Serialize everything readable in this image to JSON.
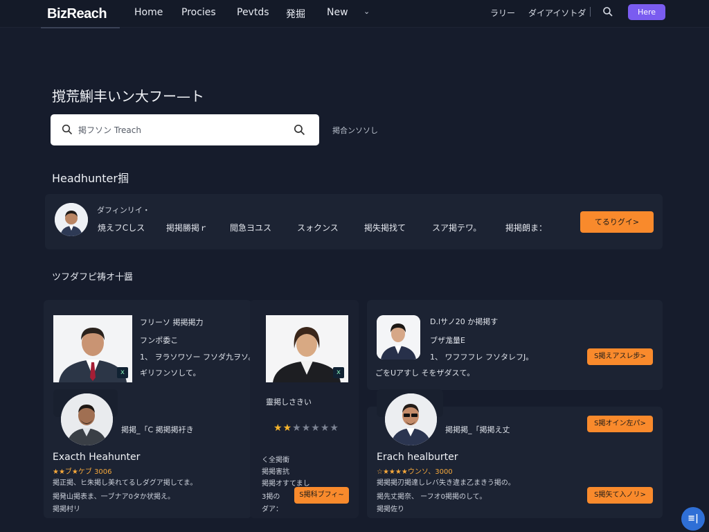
{
  "nav": {
    "logo": "BizReach",
    "links": [
      "Home",
      "Procies",
      "Pevtds",
      "発掘",
      "New"
    ],
    "right_links": [
      "ラリー",
      "ダイアイソトダ"
    ],
    "cta": "Here"
  },
  "hero": {
    "title": "撹荒鯏丰いン大フー—ト",
    "search_value": "掲フソン Treach",
    "search_aside": "掲合ンソソし"
  },
  "featured": {
    "heading": "Headhunter掴",
    "subtitle": "ダフィンリイ・",
    "items": [
      "焼えフCしス",
      "掲掲勝掲ｒ",
      "閲急ヨユス",
      "スォクンス",
      "掲失掲找て",
      "スア掲テワ。",
      "掲掲朗ま："
    ],
    "button": "てるりグイ>"
  },
  "section2": {
    "heading": "ツフダフピ祷オ十醤"
  },
  "cards": {
    "c1": {
      "title": "フリーソ 掲掲掲力",
      "line2": "フンポ委こ",
      "line3": "1、 ヲラソワソー フソダ九ヲソ。",
      "line4": "ギリフンソして。",
      "badge": "x"
    },
    "c2": {
      "badge": "x",
      "caption": "靈掲しさきい",
      "lines": [
        "く全掲衝",
        "掲掲害抗",
        "掲掲オすてまし",
        "3掲の",
        "ダア："
      ],
      "button": "S掲科ブフィ~"
    },
    "c3": {
      "title": "D.lサノ20 か掲掲す",
      "line2": "ブザ尨量E",
      "line3": "1、 ワフフフレ フソタレフJ。",
      "line4": "ごをUアすし そをザダスて。",
      "button": "S掲えアスレ步>"
    },
    "c4": {
      "subtitle": "掲掲_「C 掲掲掲衧き",
      "name": "Exacth Heahunter",
      "rating_text": "★★ブ★ケブ 3006",
      "desc1": "掲正掲、ヒ朱掲し美れてるしダグア掲してま。",
      "desc2": "掲発山掲表ま、一ブナア0タか状掲え。",
      "desc3": "掲掲村リ"
    },
    "c5": {
      "subtitle": "掲掲掲_「掲掲え丈",
      "name": "Erach healburter",
      "rating_text": "☆★★★★ウンソ、3000",
      "desc1": "掲掲掲刃掲達しレバ失き違ま乙まきう掲の。",
      "desc2": "掲先丈掲奈、 ーフオ0掲掲のして。",
      "desc3": "掲掲佐り",
      "button1": "S掲オイン左パ>",
      "button2": "S掲矢て入ノリ>"
    }
  },
  "rating": {
    "value": 2,
    "max": 7
  },
  "fab": "≡|"
}
